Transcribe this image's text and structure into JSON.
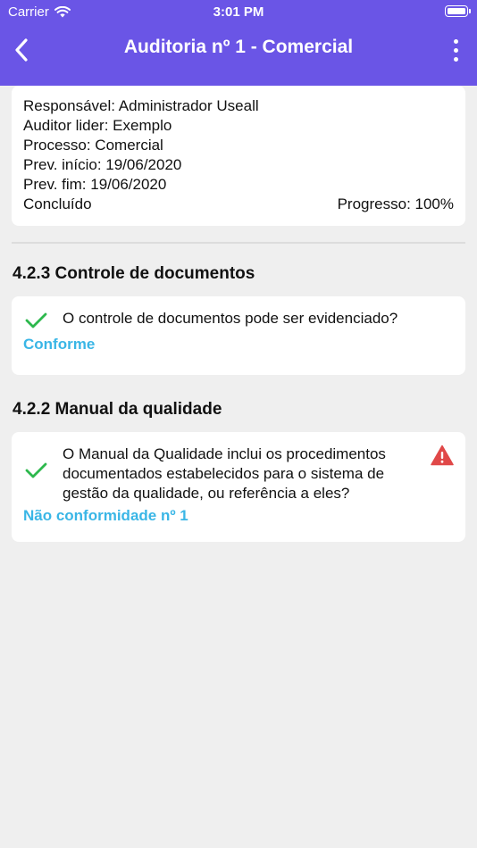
{
  "status_bar": {
    "carrier": "Carrier",
    "time": "3:01 PM"
  },
  "nav": {
    "title": "Auditoria nº 1 - Comercial"
  },
  "info": {
    "responsavel": "Responsável: Administrador Useall",
    "auditor": "Auditor lider: Exemplo",
    "processo": "Processo: Comercial",
    "prev_inicio": "Prev. início: 19/06/2020",
    "prev_fim": "Prev. fim: 19/06/2020",
    "status": "Concluído",
    "progresso": "Progresso: 100%"
  },
  "sections": [
    {
      "title": "4.2.3 Controle de documentos",
      "question": "O controle de documentos pode ser evidenciado?",
      "result": "Conforme"
    },
    {
      "title": "4.2.2 Manual da qualidade",
      "question": "O Manual da Qualidade inclui os procedimentos documentados estabelecidos para o sistema de gestão da qualidade, ou referência a eles?",
      "result": "Não conformidade nº 1"
    }
  ],
  "colors": {
    "accent": "#6a55e6",
    "link": "#3ab6e6",
    "check": "#2db84d",
    "warning": "#e04848"
  },
  "icons": [
    "wifi-icon",
    "battery-icon",
    "back-chevron-icon",
    "more-vertical-icon",
    "check-icon",
    "warning-icon"
  ]
}
